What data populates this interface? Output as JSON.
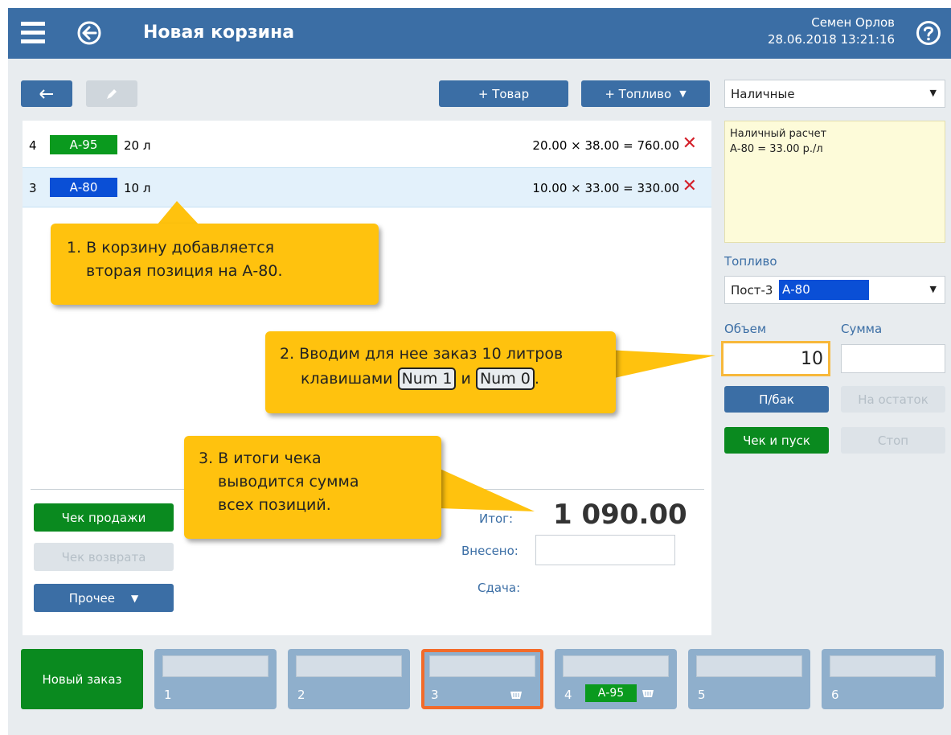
{
  "header": {
    "title": "Новая корзина",
    "user_name": "Семен Орлов",
    "datetime": "28.06.2018 13:21:16"
  },
  "toolbar": {
    "add_goods": "+ Товар",
    "add_fuel": "+ Топливо"
  },
  "cart": {
    "items": [
      {
        "num": "4",
        "fuel": "А-95",
        "volume": "20 л",
        "calc": "20.00 × 38.00 = 760.00",
        "tag_color": "#0a9a1e"
      },
      {
        "num": "3",
        "fuel": "А-80",
        "volume": "10 л",
        "calc": "10.00 × 33.00 = 330.00",
        "tag_color": "#0a4fd6"
      }
    ],
    "total_label": "Итог:",
    "total_value": "1 090.00",
    "paid_label": "Внесено:",
    "change_label": "Сдача:",
    "sale_receipt": "Чек продажи",
    "return_receipt": "Чек возврата",
    "other": "Прочее"
  },
  "payment": {
    "method": "Наличные",
    "note_line1": "Наличный расчет",
    "note_line2": "А-80 = 33.00 р./л"
  },
  "fuel": {
    "label": "Топливо",
    "pump": "Пост-3",
    "grade": "А-80",
    "volume_label": "Объем",
    "sum_label": "Сумма",
    "volume_value": "10",
    "full_tank": "П/бак",
    "remainder": "На остаток",
    "check_start": "Чек и пуск",
    "stop": "Стоп"
  },
  "callouts": {
    "c1_line1": "1. В корзину добавляется",
    "c1_line2": "вторая позиция на А-80.",
    "c2_line1": "2. Вводим для нее заказ 10 литров",
    "c2_pre": "клавишами",
    "c2_key1": "Num 1",
    "c2_mid": "и",
    "c2_key2": "Num 0",
    "c2_post": ".",
    "c3_line1": "3. В итоги чека",
    "c3_line2": "выводится сумма",
    "c3_line3": "всех позиций."
  },
  "tabs": {
    "new_order": "Новый заказ",
    "items": [
      "1",
      "2",
      "3",
      "4",
      "5",
      "6"
    ],
    "tab4_fuel": "А-95"
  }
}
